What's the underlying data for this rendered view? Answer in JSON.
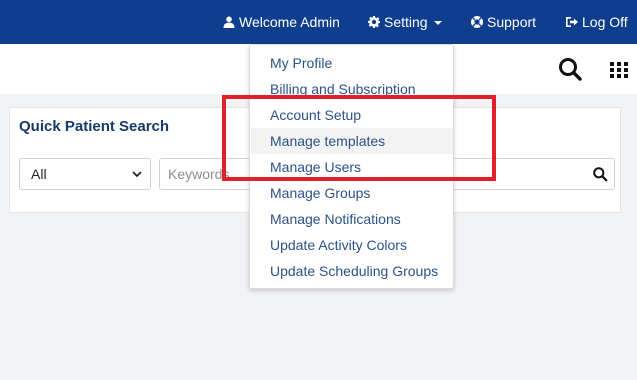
{
  "topnav": {
    "welcome_label": "Welcome Admin",
    "setting_label": "Setting",
    "support_label": "Support",
    "logoff_label": "Log Off",
    "background": "#0f3e8f"
  },
  "search_panel": {
    "title": "Quick Patient Search",
    "filter_value": "All",
    "keyword_placeholder": "Keywords"
  },
  "settings_menu": {
    "items": [
      {
        "label": "My Profile"
      },
      {
        "label": "Billing and Subscription"
      },
      {
        "label": "Account Setup"
      },
      {
        "label": "Manage templates"
      },
      {
        "label": "Manage Users"
      },
      {
        "label": "Manage Groups"
      },
      {
        "label": "Manage Notifications"
      },
      {
        "label": "Update Activity Colors"
      },
      {
        "label": "Update Scheduling Groups"
      }
    ]
  },
  "colors": {
    "link": "#2a5289",
    "highlight": "#e0202b"
  }
}
